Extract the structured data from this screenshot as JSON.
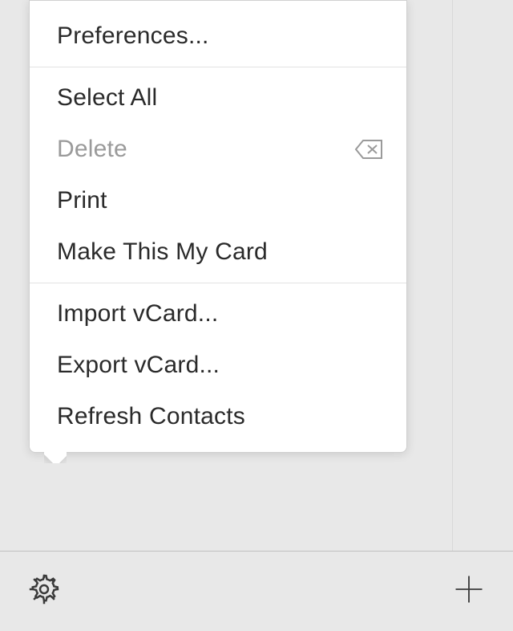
{
  "menu": {
    "groups": [
      {
        "items": [
          {
            "key": "preferences",
            "label": "Preferences...",
            "disabled": false
          }
        ]
      },
      {
        "items": [
          {
            "key": "select-all",
            "label": "Select All",
            "disabled": false
          },
          {
            "key": "delete",
            "label": "Delete",
            "disabled": true,
            "icon": "delete-icon"
          },
          {
            "key": "print",
            "label": "Print",
            "disabled": false
          },
          {
            "key": "make-my-card",
            "label": "Make This My Card",
            "disabled": false
          }
        ]
      },
      {
        "items": [
          {
            "key": "import-vcard",
            "label": "Import vCard...",
            "disabled": false
          },
          {
            "key": "export-vcard",
            "label": "Export vCard...",
            "disabled": false
          },
          {
            "key": "refresh-contacts",
            "label": "Refresh Contacts",
            "disabled": false
          }
        ]
      }
    ]
  }
}
